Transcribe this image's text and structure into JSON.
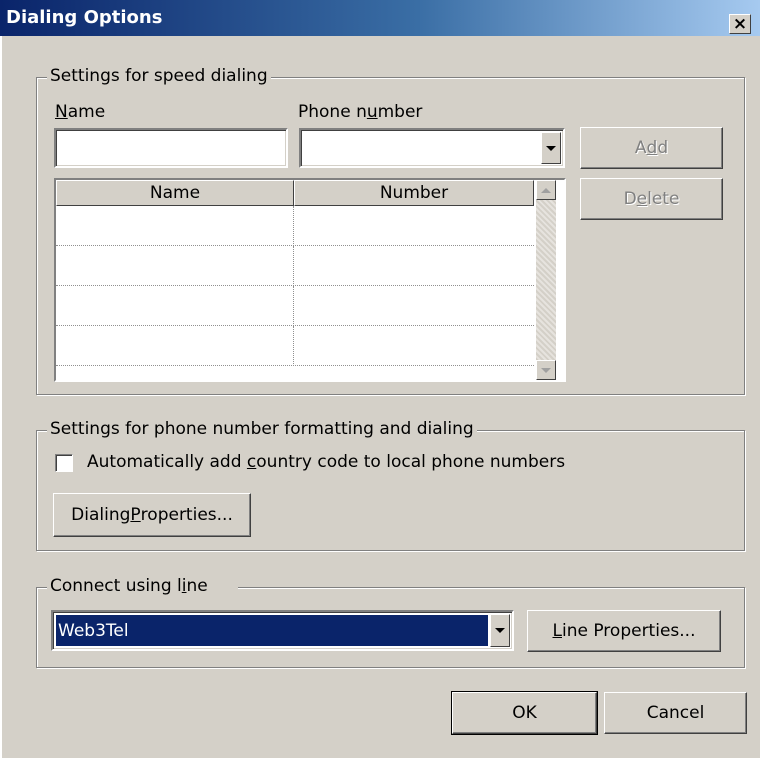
{
  "window": {
    "title": "Dialing Options",
    "close_glyph": "×"
  },
  "speed_dialing": {
    "legend": "Settings for speed dialing",
    "name_label_prefix": "",
    "name_label_accel": "N",
    "name_label_rest": "ame",
    "phone_label_prefix": "Phone n",
    "phone_label_accel": "u",
    "phone_label_rest": "mber",
    "name_value": "",
    "phone_value": "",
    "add_prefix": "A",
    "add_accel": "d",
    "add_rest": "d",
    "delete_prefix": "D",
    "delete_accel": "e",
    "delete_rest": "lete",
    "columns": [
      "Name",
      "Number"
    ],
    "rows": [
      {
        "name": "",
        "number": ""
      },
      {
        "name": "",
        "number": ""
      },
      {
        "name": "",
        "number": ""
      },
      {
        "name": "",
        "number": ""
      }
    ]
  },
  "formatting": {
    "legend": "Settings for phone number formatting and dialing",
    "checkbox_prefix": "Automatically add ",
    "checkbox_accel": "c",
    "checkbox_rest": "ountry code to local phone numbers",
    "checkbox_checked": false,
    "dialing_props_prefix": "Dialing ",
    "dialing_props_accel": "P",
    "dialing_props_rest": "roperties..."
  },
  "connect": {
    "legend_prefix": "Connect using l",
    "legend_accel": "i",
    "legend_rest": "ne",
    "line_value": "Web3Tel",
    "line_props_prefix": "",
    "line_props_accel": "L",
    "line_props_rest": "ine Properties..."
  },
  "footer": {
    "ok_label": "OK",
    "cancel_label": "Cancel"
  },
  "colors": {
    "face": "#d4d0c8",
    "selection": "#0a246a",
    "title_start": "#0a246a",
    "title_end": "#a6caf0"
  }
}
